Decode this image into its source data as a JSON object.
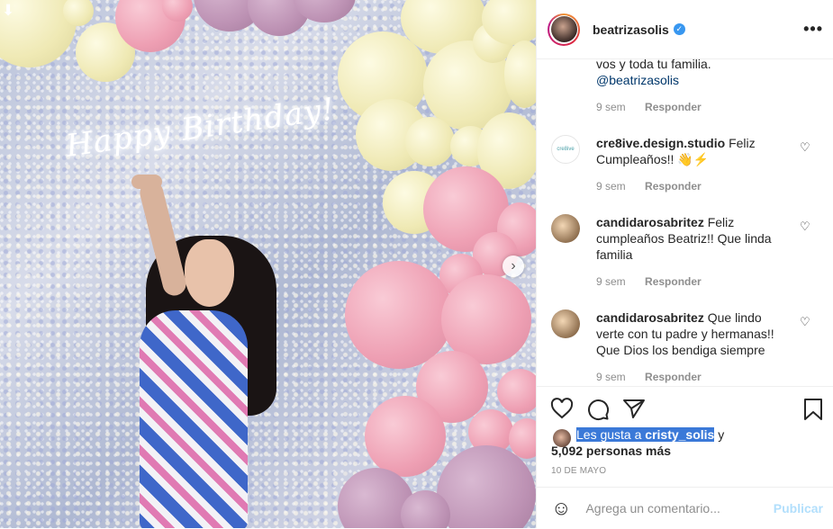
{
  "post": {
    "username": "beatrizasolis",
    "more_label": "•••"
  },
  "photo": {
    "neon_text": "Happy Birthday!"
  },
  "caption_fragment": {
    "line1": "vos y toda tu familia.",
    "mention": "@beatrizasolis",
    "time": "9 sem",
    "reply": "Responder"
  },
  "comments": [
    {
      "username": "cre8ive.design.studio",
      "text": "Feliz Cumpleaños!! 👋⚡",
      "time": "9 sem",
      "reply": "Responder"
    },
    {
      "username": "candidarosabritez",
      "text": "Feliz cumpleaños Beatriz!! Que linda familia",
      "time": "9 sem",
      "reply": "Responder"
    },
    {
      "username": "candidarosabritez",
      "text": "Que lindo verte con tu padre y hermanas!! Que Dios los bendiga siempre",
      "time": "9 sem",
      "reply": "Responder"
    }
  ],
  "likes": {
    "prefix": "Les gusta a ",
    "user": "cristy_solis",
    "suffix": " y",
    "count_text": "5,092 personas más"
  },
  "date": "10 DE MAYO",
  "add_comment": {
    "placeholder": "Agrega un comentario...",
    "publish": "Publicar"
  }
}
